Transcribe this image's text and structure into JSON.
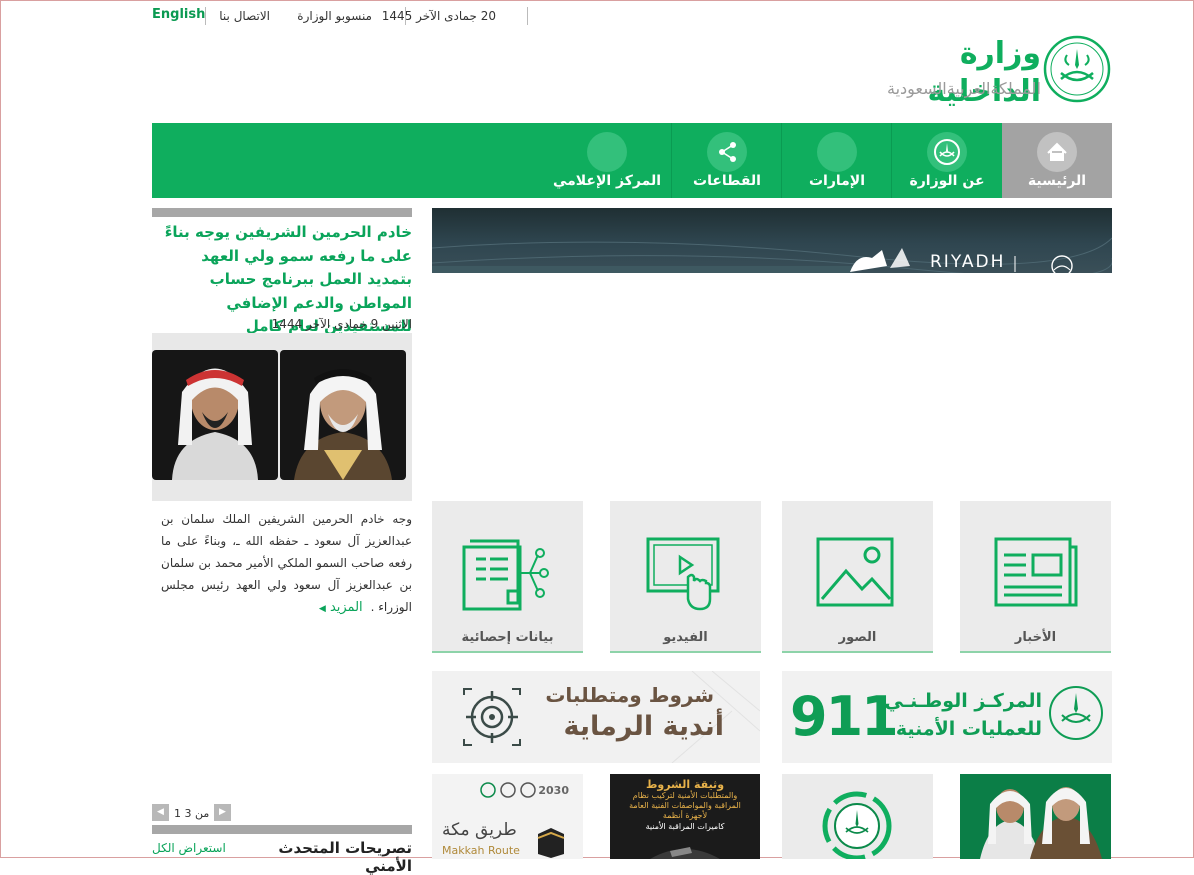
{
  "topbar": {
    "date": "20 جمادى الآخر 1445",
    "staff": "منسوبو الوزارة",
    "contact": "الاتصال بنا",
    "english": "English"
  },
  "logo": {
    "title": "وزارة الداخلية",
    "subtitle": "المملكةالعربيةالسعودية"
  },
  "nav": {
    "items": [
      {
        "label": "الرئيسية",
        "icon": "home-icon"
      },
      {
        "label": "عن الوزارة",
        "icon": "emblem-icon"
      },
      {
        "label": "الإمارات",
        "icon": "circle-icon"
      },
      {
        "label": "القطاعات",
        "icon": "share-icon"
      },
      {
        "label": "المركز الإعلامي",
        "icon": "circle-icon"
      }
    ]
  },
  "news": {
    "headline": "خادم الحرمين الشريفين يوجه بناءً على ما رفعه سمو ولي العهد بتمديد العمل ببرنامج حساب المواطن والدعم الإضافي للمستفيدين لعام كامل",
    "date": "الاثنين 9 جمادى الآخر 1444",
    "body": "وجه خادم الحرمين الشريفين الملك سلمان بن عبدالعزيز آل سعود ـ حفظه الله ـ، وبناءً على ما رفعه صاحب السمو الملكي الأمير محمد بن سلمان بن عبدالعزيز آل سعود ولي العهد رئيس مجلس الوزراء .",
    "more": "المزيد",
    "pager": "1 من 3"
  },
  "speaker": {
    "title": "تصريحات المتحدث الأمني",
    "view_all": "استعراض الكل"
  },
  "banner": {
    "text": "RIYADH"
  },
  "tiles": [
    {
      "label": "الأخبار",
      "icon": "newspaper-icon"
    },
    {
      "label": "الصور",
      "icon": "image-icon"
    },
    {
      "label": "الفيديو",
      "icon": "video-icon"
    },
    {
      "label": "بيانات إحصائية",
      "icon": "statistics-icon"
    }
  ],
  "promos": {
    "center911_line1": "المركـز الوطـنـي",
    "center911_line2": "للعمليات الأمنية",
    "center911_number": "911",
    "shooting_line1": "شروط ومتطلبات",
    "shooting_line2": "أندية الرماية"
  },
  "bottom_tiles": {
    "surveillance_line1": "وثيقة الشروط",
    "surveillance_line2": "والمتطلبات الأمنية لتركيب نظام",
    "surveillance_line3": "المراقبة والمواصفات الفنية العامة",
    "surveillance_line4": "لأجهزة أنظمة",
    "surveillance_line5": "كاميرات المراقبة الأمنية",
    "makkah_ar": "طريق مكة",
    "makkah_en": "Makkah Route",
    "vision": "2030"
  },
  "colors": {
    "brand_green": "#0fae5e",
    "nav_home_gray": "#a3a3a3",
    "text_green": "#0aa45a"
  }
}
